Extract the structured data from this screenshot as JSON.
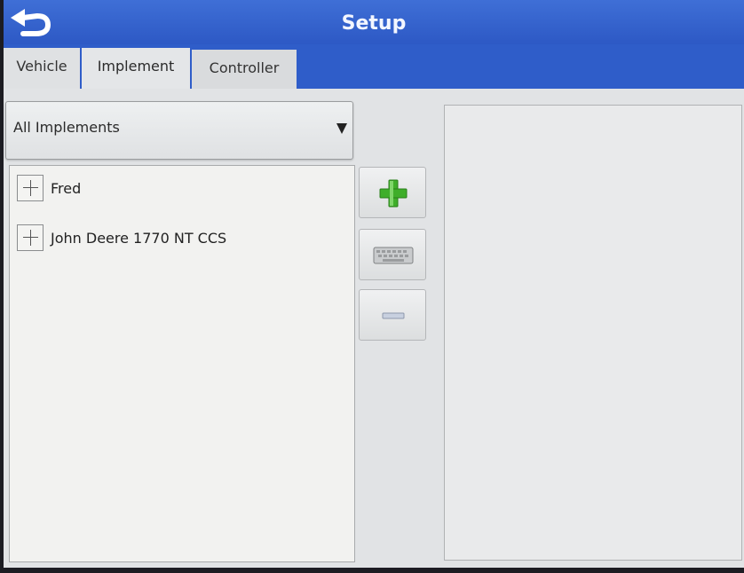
{
  "header": {
    "title": "Setup"
  },
  "tabs": [
    {
      "label": "Vehicle",
      "active": false
    },
    {
      "label": "Implement",
      "active": true
    },
    {
      "label": "Controller",
      "active": false
    }
  ],
  "filter": {
    "selected": "All Implements"
  },
  "implements": [
    {
      "label": "Fred"
    },
    {
      "label": "John Deere 1770 NT CCS"
    }
  ],
  "icons": {
    "back": "back-arrow-icon",
    "add": "plus-icon",
    "edit": "keyboard-icon",
    "remove": "minus-icon",
    "dropdown": "dropdown-arrow-icon"
  },
  "colors": {
    "title_bar": "#2a55c2",
    "add_green": "#3fae2a"
  }
}
